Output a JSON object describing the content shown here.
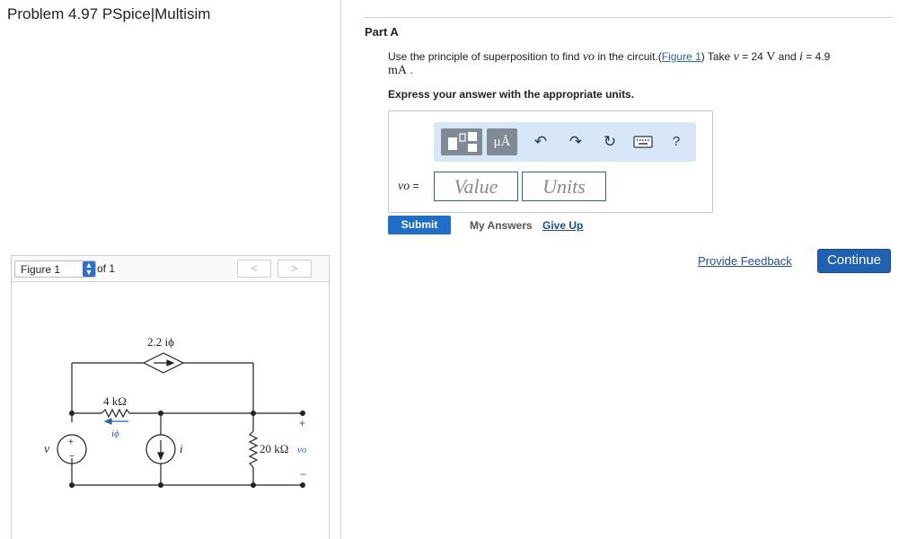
{
  "problem": {
    "title": "Problem 4.97 PSpice|Multisim"
  },
  "figure_nav": {
    "selected": "Figure 1",
    "of_label": "of 1",
    "prev": "<",
    "next": ">"
  },
  "circuit": {
    "dep_source_label": "2.2 iϕ",
    "r1_label": "4 kΩ",
    "r2_label": "20 kΩ",
    "current_label": "iϕ",
    "source_v": "v",
    "source_i": "i",
    "out_label": "vo",
    "plus": "+",
    "minus": "−"
  },
  "part": {
    "label": "Part A",
    "question_pre": "Use the principle of superposition to find",
    "question_var": "vo",
    "question_mid1": "in the circuit.(",
    "figure_link": "Figure 1",
    "question_mid2": ") Take",
    "v_var": "v",
    "v_eq": "= 24",
    "v_unit": "V",
    "and": "and",
    "i_var": "i",
    "i_eq": "= 4.9",
    "i_unit": "mA",
    "end": ".",
    "instruction": "Express your answer with the appropriate units."
  },
  "answer": {
    "var_name": "vo",
    "eq": "=",
    "value_placeholder": "Value",
    "units_placeholder": "Units",
    "toolbar": {
      "units_button": "μÅ",
      "undo_icon": "undo-icon",
      "redo_icon": "redo-icon",
      "reset_icon": "reset-icon",
      "keyboard_icon": "keyboard-icon",
      "help": "?"
    }
  },
  "actions": {
    "submit": "Submit",
    "my_answers": "My Answers",
    "give_up": "Give Up",
    "feedback": "Provide Feedback",
    "continue": "Continue"
  },
  "colors": {
    "link": "#1d4f9a",
    "submit_bg": "#1d6fc9",
    "continue_bg": "#1f62b3",
    "toolbar_bg": "#d7e7f8"
  }
}
